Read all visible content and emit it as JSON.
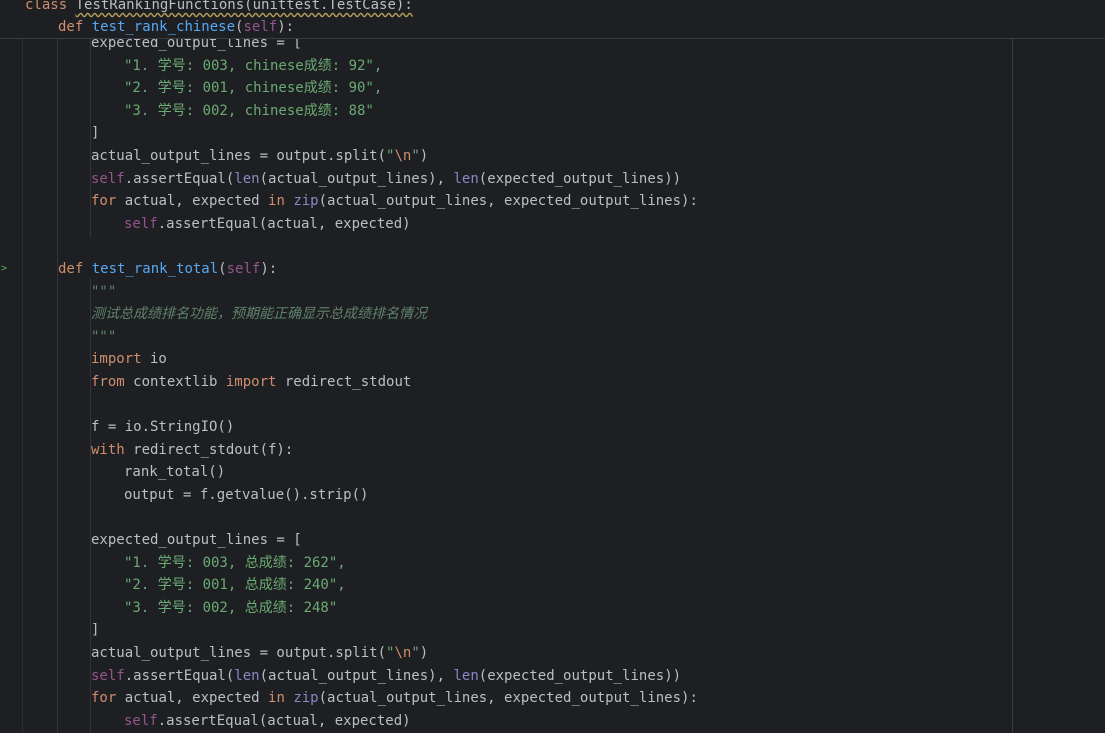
{
  "editor": {
    "language": "python",
    "colors": {
      "background": "#1e1f22",
      "keyword": "#cf8e6d",
      "function": "#56a8f5",
      "self": "#94558d",
      "string": "#6aab73",
      "builtin": "#8888c6",
      "docstring": "#5f826b",
      "text": "#bcbec4"
    },
    "sticky": {
      "class_kw": "class",
      "class_name": "TestRankingFunctions(unittest.TestCase):",
      "def_kw": "def",
      "def_name": "test_rank_chinese",
      "def_open": "(",
      "def_self": "self",
      "def_close": "):"
    },
    "lines": {
      "l1": "expected_output_lines = [",
      "l2": "\"1. 学号: 003, chinese成绩: 92\",",
      "l3": "\"2. 学号: 001, chinese成绩: 90\",",
      "l4": "\"3. 学号: 002, chinese成绩: 88\"",
      "l5": "]",
      "l6_a": "actual_output_lines = output.split(",
      "l6_s1": "\"",
      "l6_esc": "\\n",
      "l6_s2": "\"",
      "l6_b": ")",
      "l7_self": "self",
      "l7_a": ".assertEqual(",
      "l7_len1": "len",
      "l7_b": "(actual_output_lines), ",
      "l7_len2": "len",
      "l7_c": "(expected_output_lines))",
      "l8_for": "for",
      "l8_a": " actual, expected ",
      "l8_in": "in",
      "l8_sp": " ",
      "l8_zip": "zip",
      "l8_b": "(actual_output_lines, expected_output_lines):",
      "l9_self": "self",
      "l9_a": ".assertEqual(actual, expected)",
      "l11_def": "def",
      "l11_name": "test_rank_total",
      "l11_open": "(",
      "l11_self": "self",
      "l11_close": "):",
      "l12": "\"\"\"",
      "l13": "测试总成绩排名功能，预期能正确显示总成绩排名情况",
      "l14": "\"\"\"",
      "l15_import": "import",
      "l15_a": " io",
      "l16_from": "from",
      "l16_a": " contextlib ",
      "l16_import": "import",
      "l16_b": " redirect_stdout",
      "l18": "f = io.StringIO()",
      "l19_with": "with",
      "l19_a": " redirect_stdout(f):",
      "l20": "rank_total()",
      "l21": "output = f.getvalue().strip()",
      "l23": "expected_output_lines = [",
      "l24": "\"1. 学号: 003, 总成绩: 262\",",
      "l25": "\"2. 学号: 001, 总成绩: 240\",",
      "l26": "\"3. 学号: 002, 总成绩: 248\"",
      "l27": "]",
      "l28_a": "actual_output_lines = output.split(",
      "l28_s1": "\"",
      "l28_esc": "\\n",
      "l28_s2": "\"",
      "l28_b": ")",
      "l29_self": "self",
      "l29_a": ".assertEqual(",
      "l29_len1": "len",
      "l29_b": "(actual_output_lines), ",
      "l29_len2": "len",
      "l29_c": "(expected_output_lines))",
      "l30_for": "for",
      "l30_a": " actual, expected ",
      "l30_in": "in",
      "l30_sp": " ",
      "l30_zip": "zip",
      "l30_b": "(actual_output_lines, expected_output_lines):",
      "l31_self": "self",
      "l31_a": ".assertEqual(actual, expected)"
    },
    "run_marker_icon": "run-arrow-icon"
  }
}
